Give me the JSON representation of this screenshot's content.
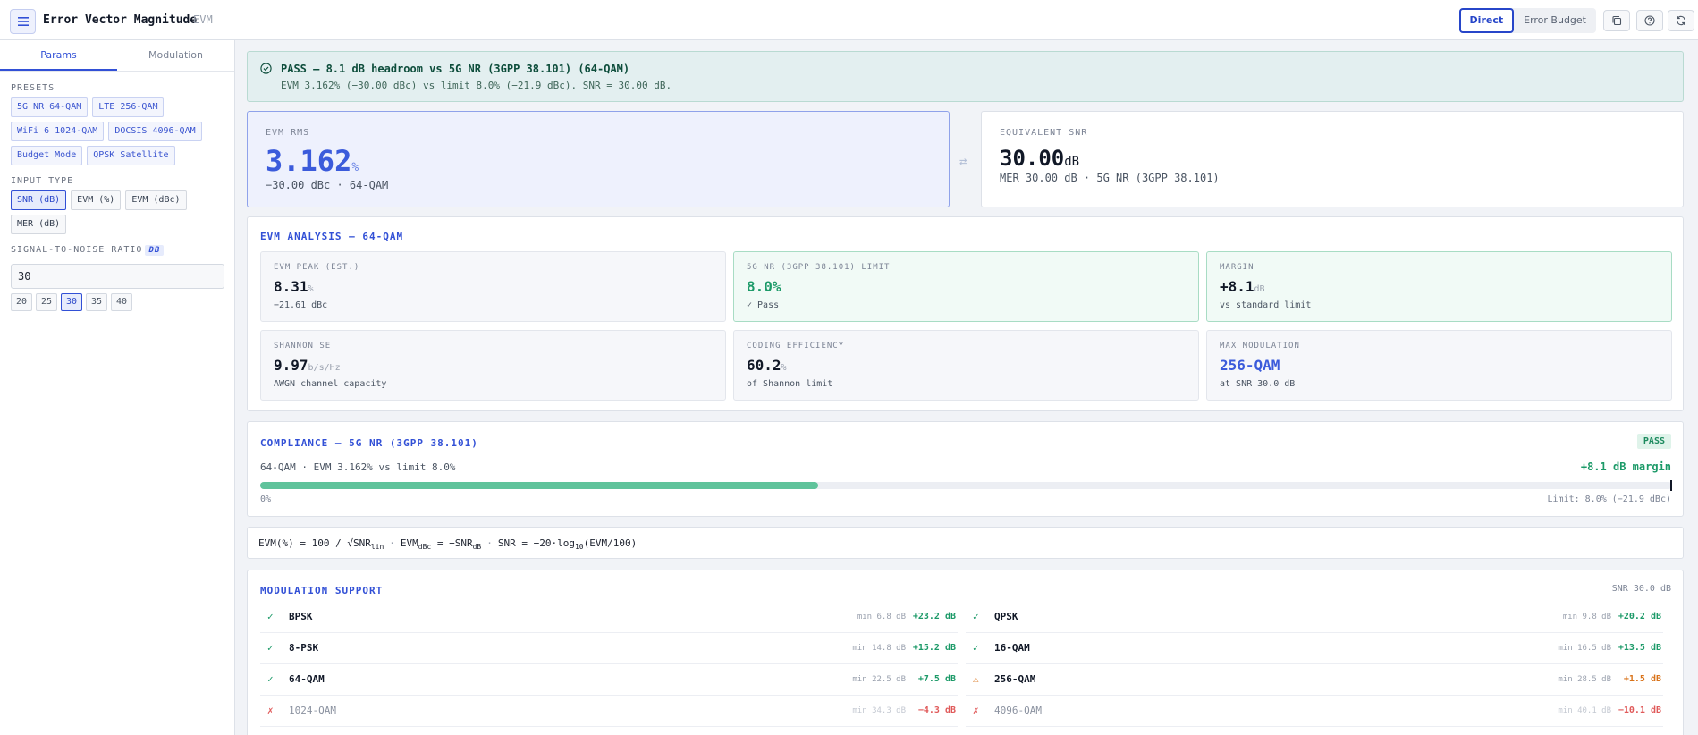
{
  "header": {
    "title": "Error Vector Magnitude",
    "abbr": "EVM",
    "modes": [
      "Direct",
      "Error Budget"
    ],
    "icons": [
      "copy-icon",
      "help-icon",
      "refresh-icon"
    ]
  },
  "sidebar": {
    "tabs": [
      "Params",
      "Modulation"
    ],
    "presets_label": "PRESETS",
    "presets": [
      "5G NR 64-QAM",
      "LTE 256-QAM",
      "WiFi 6 1024-QAM",
      "DOCSIS 4096-QAM",
      "Budget Mode",
      "QPSK Satellite"
    ],
    "input_type_label": "INPUT TYPE",
    "input_types": [
      "SNR (dB)",
      "EVM (%)",
      "EVM (dBc)",
      "MER (dB)"
    ],
    "snr_label": "SIGNAL-TO-NOISE RATIO",
    "snr_unit": "DB",
    "snr_value": "30",
    "quick_values": [
      "20",
      "25",
      "30",
      "35",
      "40"
    ]
  },
  "banner": {
    "title": "PASS — 8.1 dB headroom vs 5G NR (3GPP 38.101) (64-QAM)",
    "subtitle": "EVM 3.162% (−30.00 dBc) vs limit 8.0% (−21.9 dBc). SNR = 30.00 dB."
  },
  "evm_card": {
    "label": "EVM RMS",
    "value": "3.162",
    "unit": "%",
    "sub": "−30.00 dBc · 64-QAM"
  },
  "snr_card": {
    "label": "EQUIVALENT SNR",
    "value": "30.00",
    "unit": "dB",
    "sub": "MER 30.00 dB · 5G NR (3GPP 38.101)"
  },
  "analysis": {
    "title": "EVM ANALYSIS — 64-QAM",
    "metrics": [
      {
        "label": "EVM PEAK (EST.)",
        "value": "8.31",
        "unit": "%",
        "sub": "−21.61 dBc"
      },
      {
        "label": "5G NR (3GPP 38.101) LIMIT",
        "value": "8.0%",
        "unit": "",
        "sub": "✓ Pass"
      },
      {
        "label": "MARGIN",
        "value": "+8.1",
        "unit": "dB",
        "sub": "vs standard limit"
      },
      {
        "label": "SHANNON SE",
        "value": "9.97",
        "unit": "b/s/Hz",
        "sub": "AWGN channel capacity"
      },
      {
        "label": "CODING EFFICIENCY",
        "value": "60.2",
        "unit": "%",
        "sub": "of Shannon limit"
      },
      {
        "label": "MAX MODULATION",
        "value": "256-QAM",
        "unit": "",
        "sub": "at SNR 30.0 dB"
      }
    ]
  },
  "compliance": {
    "title": "COMPLIANCE — 5G NR (3GPP 38.101)",
    "badge": "PASS",
    "desc": "64-QAM · EVM 3.162% vs limit 8.0%",
    "margin": "+8.1 dB margin",
    "fill_fraction": 0.395,
    "min_label": "0%",
    "max_label": "Limit: 8.0% (−21.9 dBc)"
  },
  "formula": {
    "part1": "EVM(%) = 100 / √SNR",
    "part1_sub": "lin",
    "part2": "EVM",
    "part2_sub": "dBc",
    "part2_rest": " = −SNR",
    "part2_sub2": "dB",
    "part3": "SNR = −20·log",
    "part3_sub": "10",
    "part3_rest": "(EVM/100)"
  },
  "modulation": {
    "title": "MODULATION SUPPORT",
    "snr_note": "SNR 30.0 dB",
    "rows": [
      {
        "name": "BPSK",
        "min": "min 6.8 dB",
        "margin": "+23.2 dB",
        "status": "ok",
        "icon": "✓"
      },
      {
        "name": "QPSK",
        "min": "min 9.8 dB",
        "margin": "+20.2 dB",
        "status": "ok",
        "icon": "✓"
      },
      {
        "name": "8-PSK",
        "min": "min 14.8 dB",
        "margin": "+15.2 dB",
        "status": "ok",
        "icon": "✓"
      },
      {
        "name": "16-QAM",
        "min": "min 16.5 dB",
        "margin": "+13.5 dB",
        "status": "ok",
        "icon": "✓"
      },
      {
        "name": "64-QAM",
        "min": "min 22.5 dB",
        "margin": "+7.5 dB",
        "status": "ok",
        "icon": "✓"
      },
      {
        "name": "256-QAM",
        "min": "min 28.5 dB",
        "margin": "+1.5 dB",
        "status": "warn",
        "icon": "⚠"
      },
      {
        "name": "1024-QAM",
        "min": "min 34.3 dB",
        "margin": "−4.3 dB",
        "status": "bad",
        "icon": "✗"
      },
      {
        "name": "4096-QAM",
        "min": "min 40.1 dB",
        "margin": "−10.1 dB",
        "status": "bad",
        "icon": "✗"
      }
    ]
  }
}
